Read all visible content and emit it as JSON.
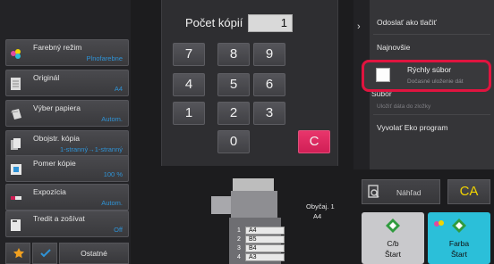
{
  "settings": [
    {
      "title": "Farebný režim",
      "value": "Plnofarebne",
      "icon": "color-mode-icon"
    },
    {
      "title": "Originál",
      "value": "A4",
      "icon": "original-icon"
    },
    {
      "title": "Výber papiera",
      "value": "Autom.",
      "icon": "paper-select-icon"
    },
    {
      "title": "Obojstr. kópia",
      "value": "1-stranný→1-stranný",
      "icon": "duplex-icon"
    },
    {
      "title": "Pomer kópie",
      "value": "100 %",
      "icon": "copy-ratio-icon"
    },
    {
      "title": "Expozícia",
      "value": "Autom.",
      "icon": "exposure-icon"
    },
    {
      "title": "Tredit a zošívat",
      "value": "Off",
      "icon": "staple-icon"
    }
  ],
  "bottom": {
    "others_label": "Ostatné"
  },
  "copies": {
    "label": "Počet kópií",
    "value": "1"
  },
  "keypad": [
    "7",
    "8",
    "9",
    "4",
    "5",
    "6",
    "1",
    "2",
    "3",
    "0",
    "C"
  ],
  "right_menu": {
    "send_print": "Odoslať ako tlačiť",
    "newest": "Najnovšie",
    "quick_file": {
      "title": "Rýchly súbor",
      "subtitle": "Dočasné uloženie dát"
    },
    "file": {
      "title": "Súbor",
      "subtitle": "Uložiť dáta do zložky"
    },
    "eco": "Vyvolať Eko program"
  },
  "preview_label": "Náhľad",
  "ca_label": "CA",
  "trays": [
    {
      "num": "1",
      "size": "A4"
    },
    {
      "num": "2",
      "size": "B5"
    },
    {
      "num": "3",
      "size": "B4"
    },
    {
      "num": "4",
      "size": "A3"
    }
  ],
  "paper_info": {
    "type": "Obyčaj. 1",
    "size": "A4"
  },
  "start_bw": {
    "line1": "C/b",
    "line2": "Štart",
    "color": "#c9c9cc"
  },
  "start_color": {
    "line1": "Farba",
    "line2": "Štart",
    "color": "#2bbfd9"
  },
  "colors": {
    "accent_blue": "#2f93d6",
    "highlight": "#e0143f",
    "clear": "#d11f56",
    "ca": "#f2d400"
  }
}
